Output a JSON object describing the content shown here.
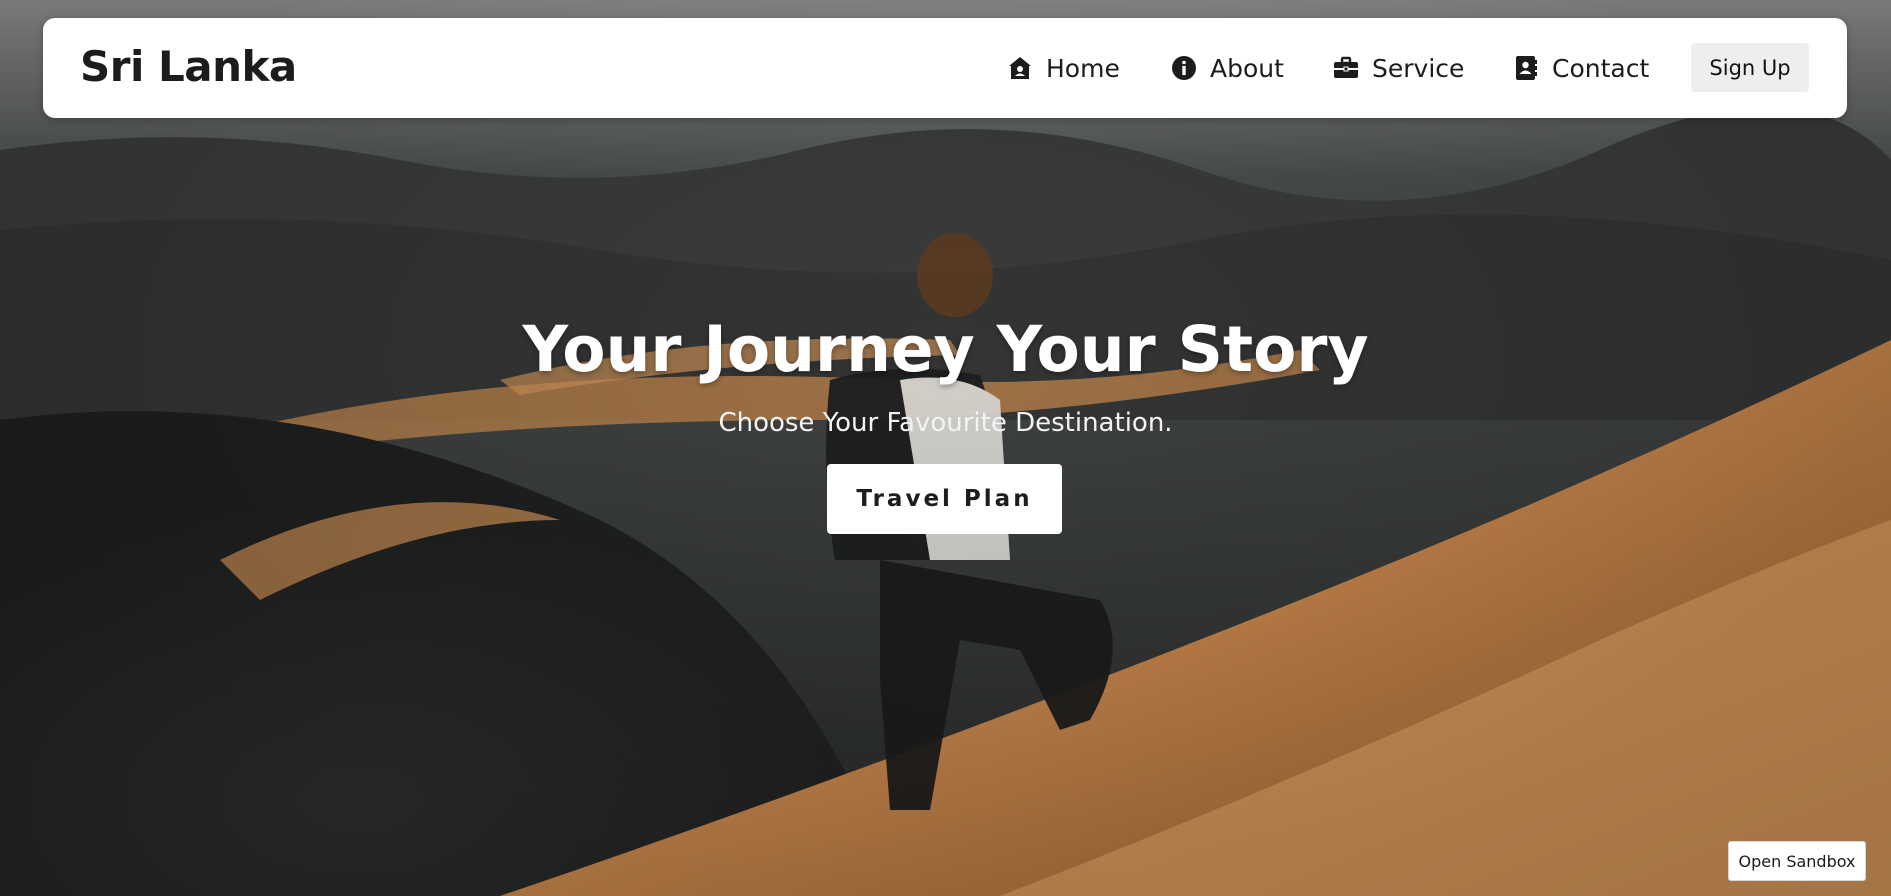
{
  "navbar": {
    "brand": "Sri Lanka",
    "items": [
      {
        "label": "Home",
        "icon": "home-icon"
      },
      {
        "label": "About",
        "icon": "info-icon"
      },
      {
        "label": "Service",
        "icon": "briefcase-icon"
      },
      {
        "label": "Contact",
        "icon": "contact-book-icon"
      }
    ],
    "signup_label": "Sign Up"
  },
  "hero": {
    "title": "Your Journey Your Story",
    "subtitle": "Choose Your Favourite Destination.",
    "cta_label": "Travel Plan"
  },
  "sandbox_button": "Open Sandbox",
  "colors": {
    "navbar_bg": "#ffffff",
    "text_dark": "#1c1c1c",
    "signup_bg": "#eeeeee",
    "sand": "#c8884a",
    "dark_dune": "#2f3131"
  }
}
